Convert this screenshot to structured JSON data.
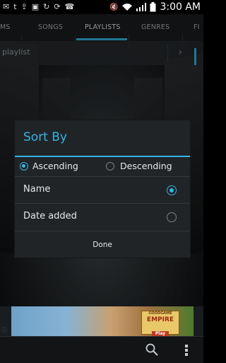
{
  "status_bar": {
    "time": "3:00 AM",
    "icons": [
      "mail-icon",
      "twitter-icon",
      "upload-icon",
      "bag-icon",
      "refresh-icon",
      "sync-icon",
      "missed-call-icon",
      "mute-icon",
      "wifi-icon",
      "signal-icon",
      "battery-icon"
    ]
  },
  "tabs": [
    {
      "label": "MS"
    },
    {
      "label": "SONGS"
    },
    {
      "label": "PLAYLISTS",
      "active": true
    },
    {
      "label": "GENRES"
    },
    {
      "label": "FI"
    }
  ],
  "add_bar": {
    "label": "playlist"
  },
  "dialog": {
    "title": "Sort By",
    "order_options": [
      {
        "label": "Ascending",
        "selected": true
      },
      {
        "label": "Descending",
        "selected": false
      }
    ],
    "sort_fields": [
      {
        "label": "Name",
        "selected": true
      },
      {
        "label": "Date added",
        "selected": false
      }
    ],
    "done_label": "Done"
  },
  "ad": {
    "brand": "GOODGAME",
    "game": "EMPIRE",
    "cta": "Play"
  },
  "colors": {
    "accent": "#33b5e5",
    "dialog_bg": "#212426"
  }
}
